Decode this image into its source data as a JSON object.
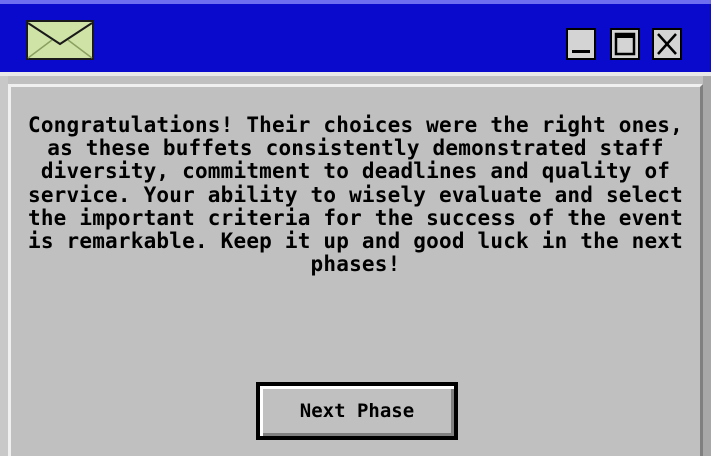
{
  "window": {
    "title_icon": "envelope-icon",
    "controls": {
      "minimize": "minimize-icon",
      "maximize": "maximize-icon",
      "close": "close-icon"
    },
    "colors": {
      "titlebar": "#0a0acd",
      "background": "#c0c0c0",
      "text": "#000000"
    }
  },
  "dialog": {
    "message": "Congratulations! Their choices were the right ones, as these buffets consistently demonstrated staff diversity, commitment to deadlines and quality of service. Your ability to wisely evaluate and select the important criteria for the success of the event is remarkable. Keep it up and good luck in the next phases!",
    "next_button_label": "Next Phase"
  }
}
